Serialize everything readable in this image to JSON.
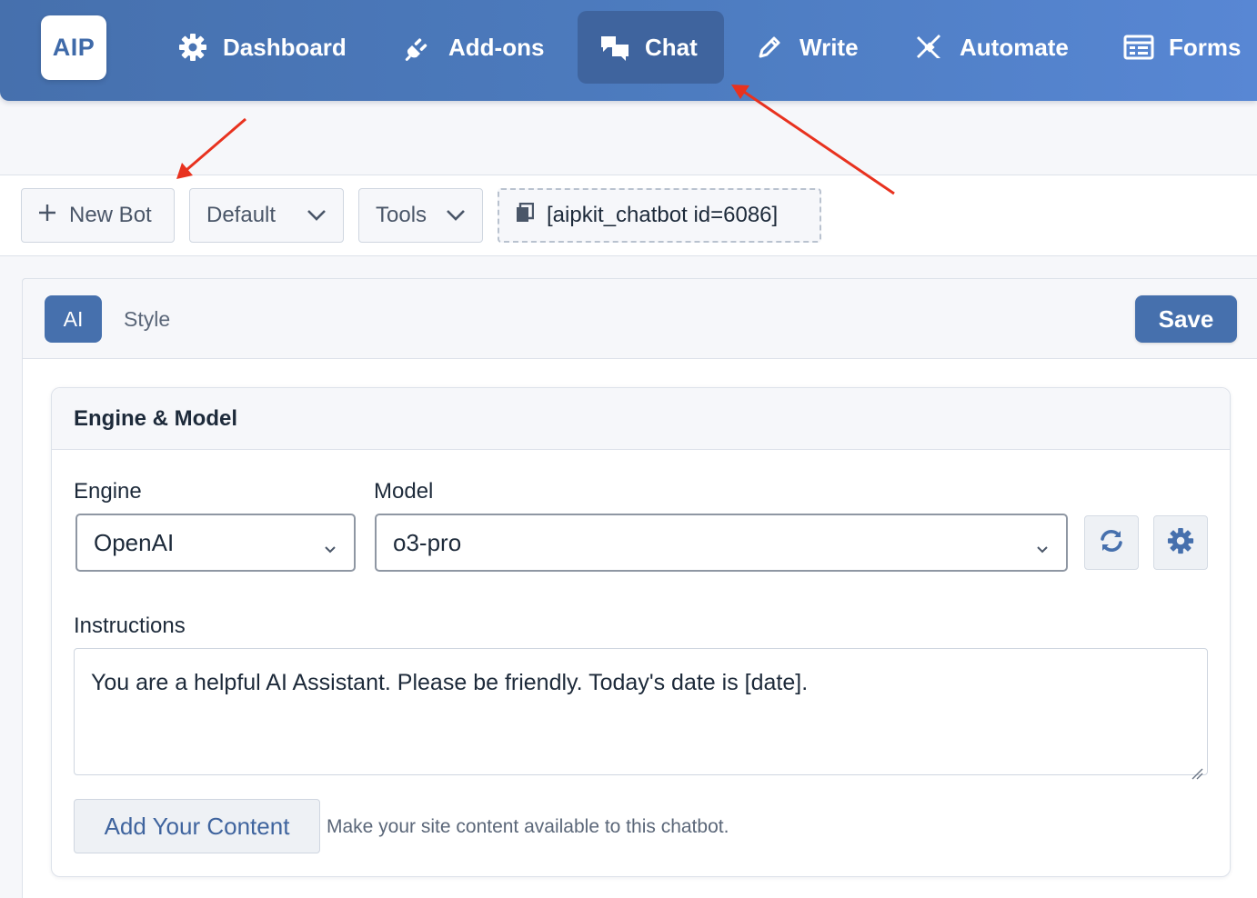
{
  "logo": {
    "text": "AIP"
  },
  "nav": {
    "items": [
      {
        "label": "Dashboard",
        "icon": "gear-icon"
      },
      {
        "label": "Add-ons",
        "icon": "plug-icon"
      },
      {
        "label": "Chat",
        "icon": "chat-bubbles-icon",
        "active": true
      },
      {
        "label": "Write",
        "icon": "pencil-icon"
      },
      {
        "label": "Automate",
        "icon": "plane-icon"
      },
      {
        "label": "Forms",
        "icon": "form-icon"
      }
    ]
  },
  "toolbar": {
    "new_bot_label": "New Bot",
    "bot_select_value": "Default",
    "tools_label": "Tools",
    "shortcode": "[aipkit_chatbot id=6086]"
  },
  "tabs": {
    "ai_label": "AI",
    "style_label": "Style",
    "save_label": "Save"
  },
  "engine_card": {
    "title": "Engine & Model",
    "engine_label": "Engine",
    "engine_value": "OpenAI",
    "model_label": "Model",
    "model_value": "o3-pro",
    "instructions_label": "Instructions",
    "instructions_value": "You are a helpful AI Assistant. Please be friendly. Today's date is [date].",
    "add_content_label": "Add Your Content",
    "add_content_hint": "Make your site content available to this chatbot."
  },
  "colors": {
    "brand": "#4670ad",
    "annotation_arrow": "#e8321f"
  }
}
